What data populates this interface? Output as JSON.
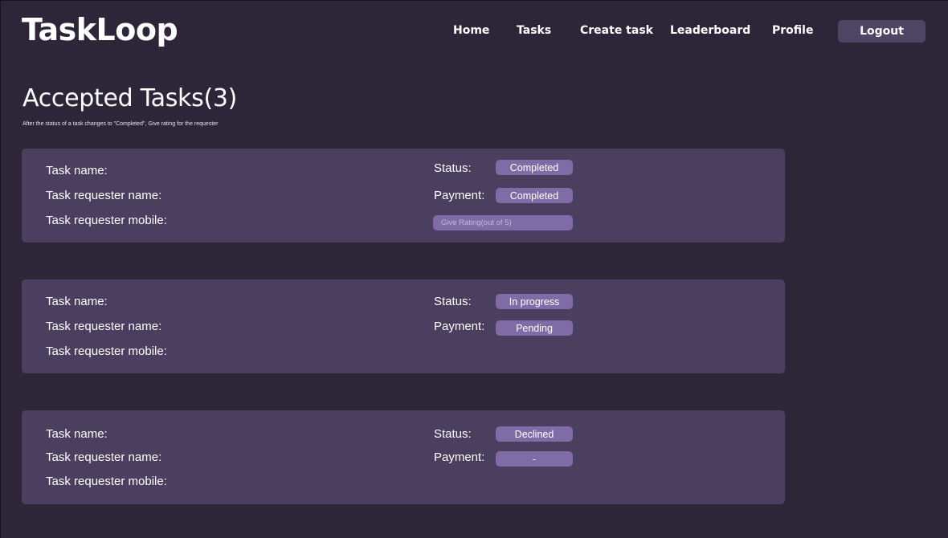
{
  "app": {
    "brand": "TaskLoop"
  },
  "nav": {
    "home": "Home",
    "tasks": "Tasks",
    "create_task": "Create task",
    "leaderboard": "Leaderboard",
    "profile": "Profile",
    "logout": "Logout"
  },
  "page": {
    "title": "Accepted Tasks(3)",
    "subtitle": "After the status of a task changes to \"Completed\", Give rating for the requester"
  },
  "labels": {
    "task_name": "Task name:",
    "requester_name": "Task requester name:",
    "requester_mobile": "Task requester mobile:",
    "status": "Status:",
    "payment": "Payment:"
  },
  "tasks": [
    {
      "status": "Completed",
      "payment": "Completed",
      "rating_placeholder": "Give Rating(out of 5)"
    },
    {
      "status": "In progress",
      "payment": "Pending"
    },
    {
      "status": "Declined",
      "payment": "-"
    }
  ],
  "colors": {
    "background": "#2d2638",
    "card": "#4a3f5e",
    "pill": "#7f6ca7",
    "logout_button": "#4e4565"
  }
}
